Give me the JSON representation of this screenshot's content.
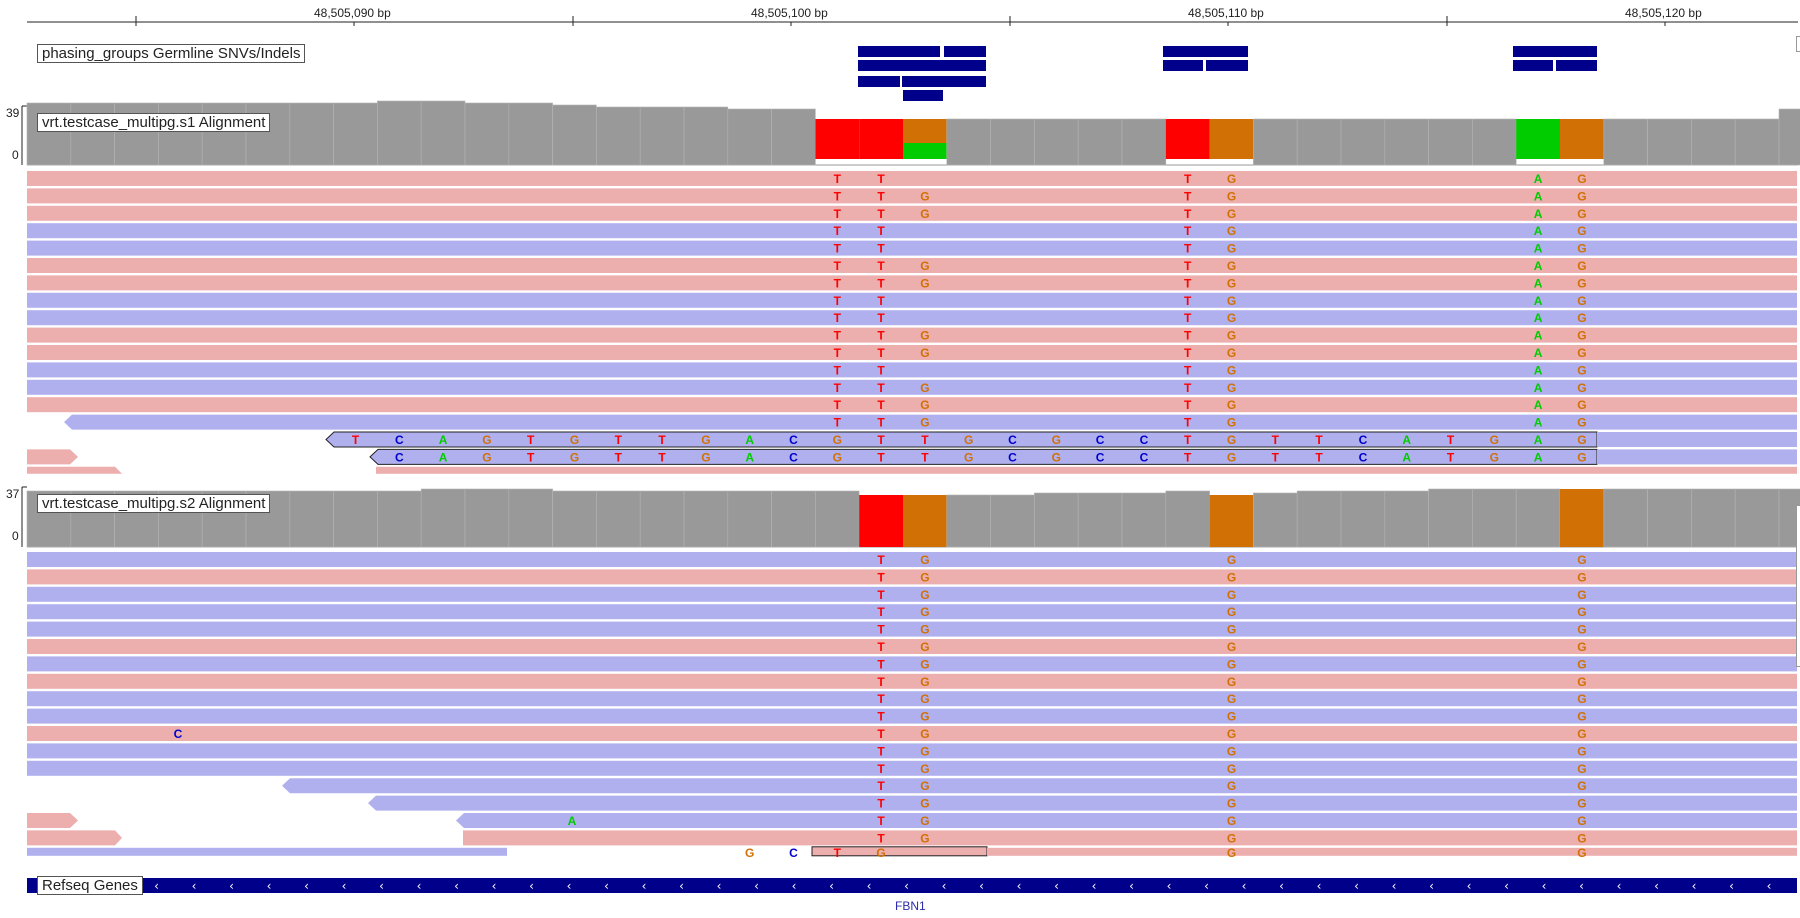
{
  "ruler": {
    "ticks": [
      "48,505,090 bp",
      "48,505,100 bp",
      "48,505,110 bp",
      "48,505,120 bp"
    ]
  },
  "tracks": {
    "phasing": {
      "label": "phasing_groups Germline SNVs/Indels"
    },
    "s1": {
      "label": "vrt.testcase_multipg.s1 Alignment",
      "coverage_max": "39",
      "coverage_min": "0"
    },
    "s2": {
      "label": "vrt.testcase_multipg.s2 Alignment",
      "coverage_max": "37",
      "coverage_min": "0"
    },
    "refseq": {
      "label": "Refseq Genes",
      "gene": "FBN1",
      "strand_glyph": "‹"
    }
  },
  "colors": {
    "forward_read": "#edaeae",
    "reverse_read": "#b0b0ee",
    "coverage": "#999999",
    "feature": "#00008b",
    "base_T": "#ff0000",
    "base_G": "#d17105",
    "base_A": "#00cc00",
    "base_C": "#0000cc"
  },
  "bases": {
    "s1_highlight_read": [
      "T",
      "C",
      "A",
      "G",
      "T",
      "G",
      "T",
      "T",
      "G",
      "A",
      "C",
      "G",
      "T",
      "T",
      "G",
      "C",
      "G",
      "C",
      "C",
      "T",
      "G",
      "T",
      "T",
      "C",
      "A",
      "T",
      "G",
      "A",
      "G"
    ],
    "s1_highlight_read_2": [
      "C",
      "A",
      "G",
      "T",
      "G",
      "T",
      "T",
      "G",
      "A",
      "C",
      "G",
      "T",
      "T",
      "G",
      "C",
      "G",
      "C",
      "C",
      "T",
      "G",
      "T",
      "T",
      "C",
      "A",
      "T",
      "G",
      "A",
      "G"
    ],
    "s1_mismatch_bases": [
      "T",
      "T",
      "G",
      "T",
      "G",
      "A",
      "G"
    ],
    "s2_mismatch_bases": [
      "T",
      "G",
      "G",
      "G"
    ],
    "s2_extra_C": "C",
    "s2_extra_A": "A",
    "s2_last_row": [
      "G",
      "C",
      "T",
      "G"
    ]
  }
}
